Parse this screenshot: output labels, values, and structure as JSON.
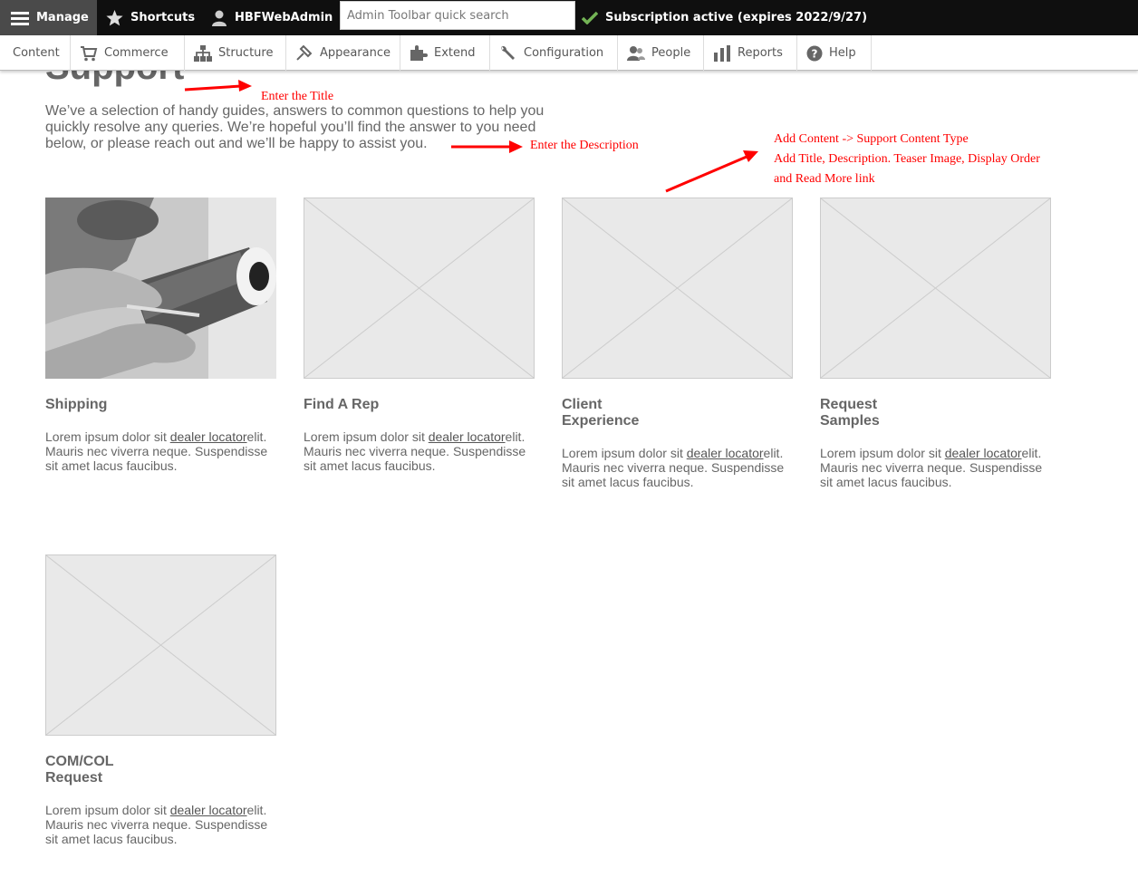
{
  "toolbar": {
    "manage": "Manage",
    "shortcuts": "Shortcuts",
    "user": "HBFWebAdmin",
    "search_placeholder": "Admin Toolbar quick search",
    "subscription": "Subscription active (expires 2022/9/27)"
  },
  "tray": {
    "items": [
      {
        "label": "Content"
      },
      {
        "label": "Commerce",
        "icon": "cart-icon"
      },
      {
        "label": "Structure",
        "icon": "structure-icon"
      },
      {
        "label": "Appearance",
        "icon": "brush-icon"
      },
      {
        "label": "Extend",
        "icon": "puzzle-icon"
      },
      {
        "label": "Configuration",
        "icon": "wrench-icon"
      },
      {
        "label": "People",
        "icon": "people-icon"
      },
      {
        "label": "Reports",
        "icon": "chart-icon"
      },
      {
        "label": "Help",
        "icon": "help-icon"
      }
    ]
  },
  "page": {
    "title": "Support",
    "description": "We’ve a selection of handy guides, answers to common questions to help you quickly resolve any queries. We’re hopeful you’ll find the answer to you need below, or please reach out and we’ll be happy to assist you."
  },
  "annotations": {
    "title_note": "Enter the Title",
    "description_note": "Enter the Description",
    "content_note_1": "Add Content -> Support Content Type",
    "content_note_2": "Add Title, Description. Teaser Image, Display Order",
    "content_note_3": "and Read More link",
    "color": "#ff0000"
  },
  "cards": [
    {
      "title": "Shipping",
      "text_before": "Lorem ipsum dolor sit ",
      "link": "dealer locator",
      "text_after": "elit. Mauris nec viverra neque. Suspendisse sit amet lacus faucibus."
    },
    {
      "title": "Find A Rep",
      "text_before": "Lorem ipsum dolor sit ",
      "link": "dealer locator",
      "text_after": "elit. Mauris nec viverra neque. Suspendisse sit amet lacus faucibus."
    },
    {
      "title": "Client Experience",
      "text_before": "Lorem ipsum dolor sit ",
      "link": "dealer locator",
      "text_after": "elit. Mauris nec viverra neque. Suspendisse sit amet lacus faucibus."
    },
    {
      "title": "Request Samples",
      "text_before": "Lorem ipsum dolor sit ",
      "link": "dealer locator",
      "text_after": "elit. Mauris nec viverra neque. Suspendisse sit amet lacus faucibus."
    },
    {
      "title": "COM/COL Request",
      "text_before": "Lorem ipsum dolor sit ",
      "link": "dealer locator",
      "text_after": "elit. Mauris nec viverra neque. Suspendisse sit amet lacus faucibus."
    }
  ]
}
